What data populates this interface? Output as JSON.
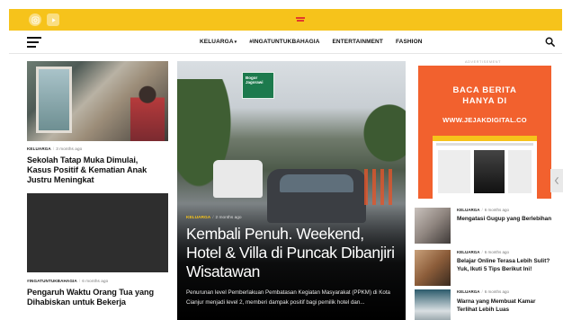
{
  "top_bar": {
    "background_color": "#f6c31b",
    "social_icons": [
      "instagram-icon",
      "youtube-icon"
    ]
  },
  "nav": {
    "menu_icon": "hamburger-icon",
    "items": [
      {
        "label": "KELUARGA",
        "has_dropdown": true
      },
      {
        "label": "#INGATUNTUKBAHAGIA",
        "has_dropdown": false
      },
      {
        "label": "ENTERTAINMENT",
        "has_dropdown": false
      },
      {
        "label": "FASHION",
        "has_dropdown": false
      }
    ],
    "search_icon": "search-icon"
  },
  "left_column": {
    "articles": [
      {
        "category": "KELUARGA",
        "time": "3 months ago",
        "title": "Sekolah Tatap Muka Dimulai, Kasus Positif & Kematian Anak Justru Meningkat"
      },
      {
        "category": "#INGATUNTUKBAHAGIA",
        "time": "6 months ago",
        "title": "Pengaruh Waktu Orang Tua yang Dihabiskan untuk Bekerja"
      }
    ]
  },
  "hero": {
    "category": "KELUARGA",
    "time": "2 months ago",
    "title": "Kembali Penuh. Weekend, Hotel & Villa di Puncak Dibanjiri Wisatawan",
    "excerpt": "Penurunan level Pemberlakuan Pembatasan Kegiatan Masyarakat (PPKM) di Kota Cianjur menjadi level 2, memberi dampak positif bagi pemilik hotel dan...",
    "sign_text": "Bogor Jagorawi",
    "accent_color": "#f6c31b"
  },
  "right_column": {
    "ad_label": "ADVERTISEMENT",
    "ad": {
      "line1": "BACA BERITA",
      "line2": "HANYA DI",
      "url": "WWW.JEJAKDIGITAL.CO",
      "background_color": "#f2612e"
    },
    "articles": [
      {
        "category": "KELUARGA",
        "time": "6 months ago",
        "title": "Mengatasi Gugup yang Berlebihan"
      },
      {
        "category": "KELUARGA",
        "time": "6 months ago",
        "title": "Belajar Online Terasa Lebih Sulit? Yuk, Ikuti 5 Tips Berikut Ini!"
      },
      {
        "category": "KELUARGA",
        "time": "6 months ago",
        "title": "Warna yang Membuat Kamar Terlihat Lebih Luas"
      }
    ]
  }
}
